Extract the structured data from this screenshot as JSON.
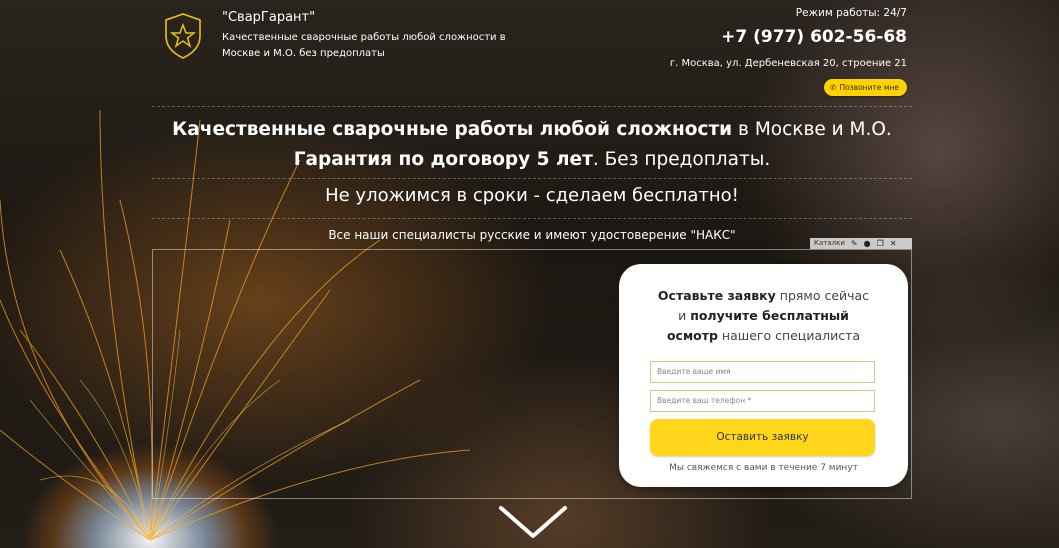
{
  "header": {
    "brand_name": "\"СварГарант\"",
    "tagline": "Качественные сварочные работы любой сложности в Москве и М.О. без предоплаты",
    "hours": "Режим работы: 24/7",
    "phone": "+7 (977) 602-56-68",
    "address": "г. Москва, ул. Дербеневская 20, строение 21",
    "call_button": "Позвоните мне"
  },
  "hero": {
    "line1_bold": "Качественные сварочные работы любой сложности",
    "line1_rest": " в Москве и М.О.",
    "line2_bold": "Гарантия по договору 5 лет",
    "line2_rest": ". Без предоплаты.",
    "subheadline": "Не уложимся в сроки - сделаем бесплатно!",
    "naks": "Все наши специалисты русские и имеют удостоверение \"НАКС\""
  },
  "editor": {
    "tools_label": "Каталки"
  },
  "form": {
    "title_part1": "Оставьте заявку",
    "title_part2": " прямо сейчас",
    "title_part3": "и ",
    "title_part4": "получите бесплатный",
    "title_part5": "осмотр",
    "title_part6": " нашего специалиста",
    "name_placeholder": "Введите ваше имя",
    "phone_placeholder": "Введите ваш телефон *",
    "submit_label": "Оставить заявку",
    "note": "Мы свяжемся с вами в течение 7 минут"
  },
  "colors": {
    "accent": "#ffd200",
    "button": "#ffd61a",
    "logo_outline": "#e8c21a"
  },
  "icons": [
    "shield-star-icon",
    "phone-icon",
    "wrench-icon",
    "drop-icon",
    "copy-icon",
    "close-icon",
    "chevron-down-icon"
  ]
}
